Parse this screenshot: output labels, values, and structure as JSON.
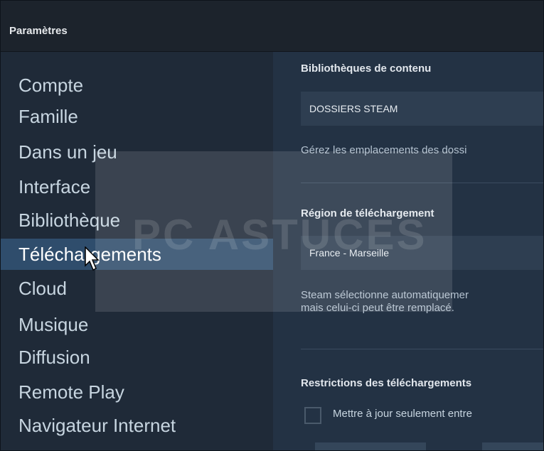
{
  "window": {
    "title": "Paramètres"
  },
  "sidebar": {
    "items": [
      {
        "label": "Compte"
      },
      {
        "label": "Famille"
      },
      {
        "label": "Dans un jeu"
      },
      {
        "label": "Interface"
      },
      {
        "label": "Bibliothèque"
      },
      {
        "label": "Téléchargements",
        "active": true
      },
      {
        "label": "Cloud"
      },
      {
        "label": "Musique"
      },
      {
        "label": "Diffusion"
      },
      {
        "label": "Remote Play"
      },
      {
        "label": "Navigateur Internet"
      }
    ]
  },
  "content": {
    "libraries": {
      "label": "Bibliothèques de contenu",
      "button": "DOSSIERS STEAM",
      "desc": "Gérez les emplacements des dossi"
    },
    "region": {
      "label": "Région de téléchargement",
      "value": "France - Marseille",
      "desc_line1": "Steam sélectionne automatiquemer",
      "desc_line2": "mais celui-ci peut être remplacé."
    },
    "restrictions": {
      "label": "Restrictions des téléchargements",
      "checkbox_label": "Mettre à jour seulement entre"
    }
  },
  "watermark": {
    "text": "PC ASTUCES"
  }
}
